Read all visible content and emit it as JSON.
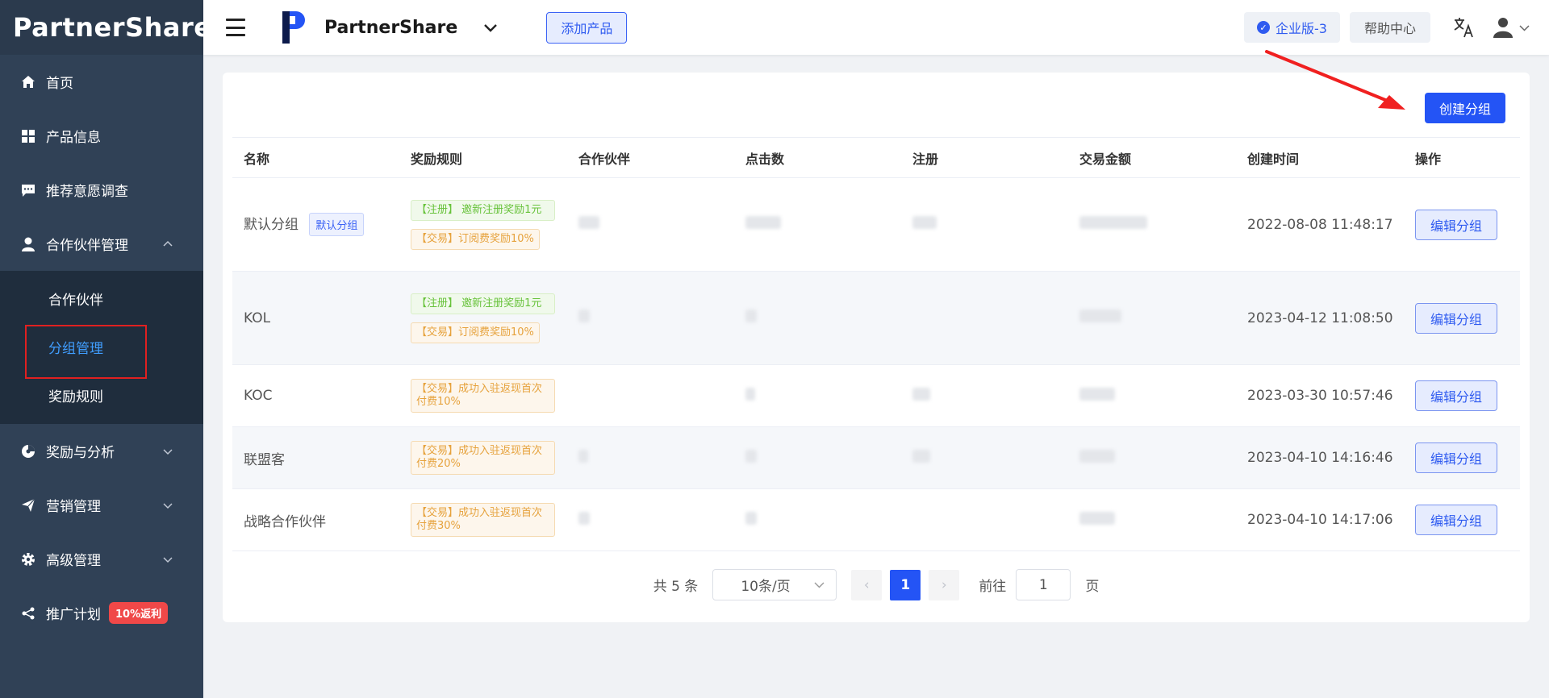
{
  "logo": "PartnerShare",
  "sidebar": {
    "items": [
      {
        "label": "首页",
        "icon": "home-icon"
      },
      {
        "label": "产品信息",
        "icon": "grid-icon"
      },
      {
        "label": "推荐意愿调查",
        "icon": "chat-icon"
      },
      {
        "label": "合作伙伴管理",
        "icon": "user-icon",
        "expanded": true,
        "children": [
          "合作伙伴",
          "分组管理",
          "奖励规则"
        ],
        "active_child": "分组管理"
      },
      {
        "label": "奖励与分析",
        "icon": "pie-icon"
      },
      {
        "label": "营销管理",
        "icon": "send-icon"
      },
      {
        "label": "高级管理",
        "icon": "gear-icon"
      },
      {
        "label": "推广计划",
        "icon": "share-icon",
        "badge": "10%返利"
      }
    ]
  },
  "header": {
    "brand": "PartnerShare",
    "add_product": "添加产品",
    "edition": "企业版-3",
    "help": "帮助中心"
  },
  "main": {
    "create_button": "创建分组",
    "columns": [
      "名称",
      "奖励规则",
      "合作伙伴",
      "点击数",
      "注册",
      "交易金额",
      "创建时间",
      "操作"
    ],
    "rows": [
      {
        "name": "默认分组",
        "tag": "默认分组",
        "rules": [
          {
            "type": "green",
            "text": "【注册】 邀新注册奖励1元"
          },
          {
            "type": "orange",
            "text": "【交易】订阅费奖励10%"
          }
        ],
        "created": "2022-08-08 11:48:17",
        "action": "编辑分组"
      },
      {
        "name": "KOL",
        "rules": [
          {
            "type": "green",
            "text": "【注册】 邀新注册奖励1元"
          },
          {
            "type": "orange",
            "text": "【交易】订阅费奖励10%"
          }
        ],
        "created": "2023-04-12 11:08:50",
        "action": "编辑分组"
      },
      {
        "name": "KOC",
        "rules": [
          {
            "type": "orange",
            "text": "【交易】成功入驻返现首次付费10%"
          }
        ],
        "created": "2023-03-30 10:57:46",
        "action": "编辑分组"
      },
      {
        "name": "联盟客",
        "rules": [
          {
            "type": "orange",
            "text": "【交易】成功入驻返现首次付费20%"
          }
        ],
        "created": "2023-04-10 14:16:46",
        "action": "编辑分组"
      },
      {
        "name": "战略合作伙伴",
        "rules": [
          {
            "type": "orange",
            "text": "【交易】成功入驻返现首次付费30%"
          }
        ],
        "created": "2023-04-10 14:17:06",
        "action": "编辑分组"
      }
    ]
  },
  "pagination": {
    "total": "共 5 条",
    "page_size": "10条/页",
    "current_page": "1",
    "goto_label": "前往",
    "goto_value": "1",
    "page_unit": "页"
  },
  "colors": {
    "sidebar": "#304156",
    "primary": "#2454f5",
    "active": "#409eff"
  }
}
